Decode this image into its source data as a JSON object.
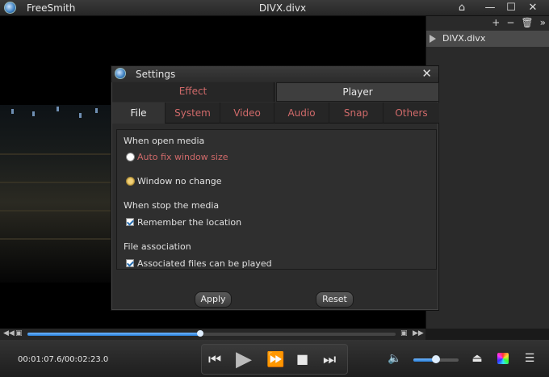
{
  "window": {
    "app_name": "FreeSmith",
    "file_title": "DIVX.divx"
  },
  "titlebar_icons": [
    "home-icon",
    "minimize-icon",
    "maximize-icon",
    "close-icon"
  ],
  "playlist": {
    "tools": {
      "add": "+",
      "remove": "−",
      "delete_icon": "trash-icon",
      "collapse": "»"
    },
    "items": [
      {
        "name": "DIVX.divx"
      }
    ]
  },
  "settings": {
    "title": "Settings",
    "main_tabs": [
      {
        "label": "Effect",
        "active": false
      },
      {
        "label": "Player",
        "active": true
      }
    ],
    "sub_tabs": [
      {
        "label": "File",
        "active": true
      },
      {
        "label": "System",
        "active": false
      },
      {
        "label": "Video",
        "active": false
      },
      {
        "label": "Audio",
        "active": false
      },
      {
        "label": "Snap",
        "active": false
      },
      {
        "label": "Others",
        "active": false
      }
    ],
    "sections": {
      "open_media": {
        "label": "When open media",
        "auto_fix": {
          "label": "Auto fix window size",
          "checked": false
        },
        "no_change": {
          "label": "Window no change",
          "checked": true
        }
      },
      "stop_media": {
        "label": "When stop the media",
        "remember": {
          "label": "Remember the location",
          "checked": true
        }
      },
      "association": {
        "label": "File association",
        "associated": {
          "label": "Associated files can be played",
          "checked": true
        }
      }
    },
    "buttons": {
      "apply": "Apply",
      "reset": "Reset"
    }
  },
  "playback": {
    "timecode": "00:01:07.6/00:02:23.0",
    "progress": 0.47,
    "volume": 0.5
  },
  "colors": {
    "accent": "#2a7fd8",
    "inactive_tab_text": "#d06a6a"
  }
}
